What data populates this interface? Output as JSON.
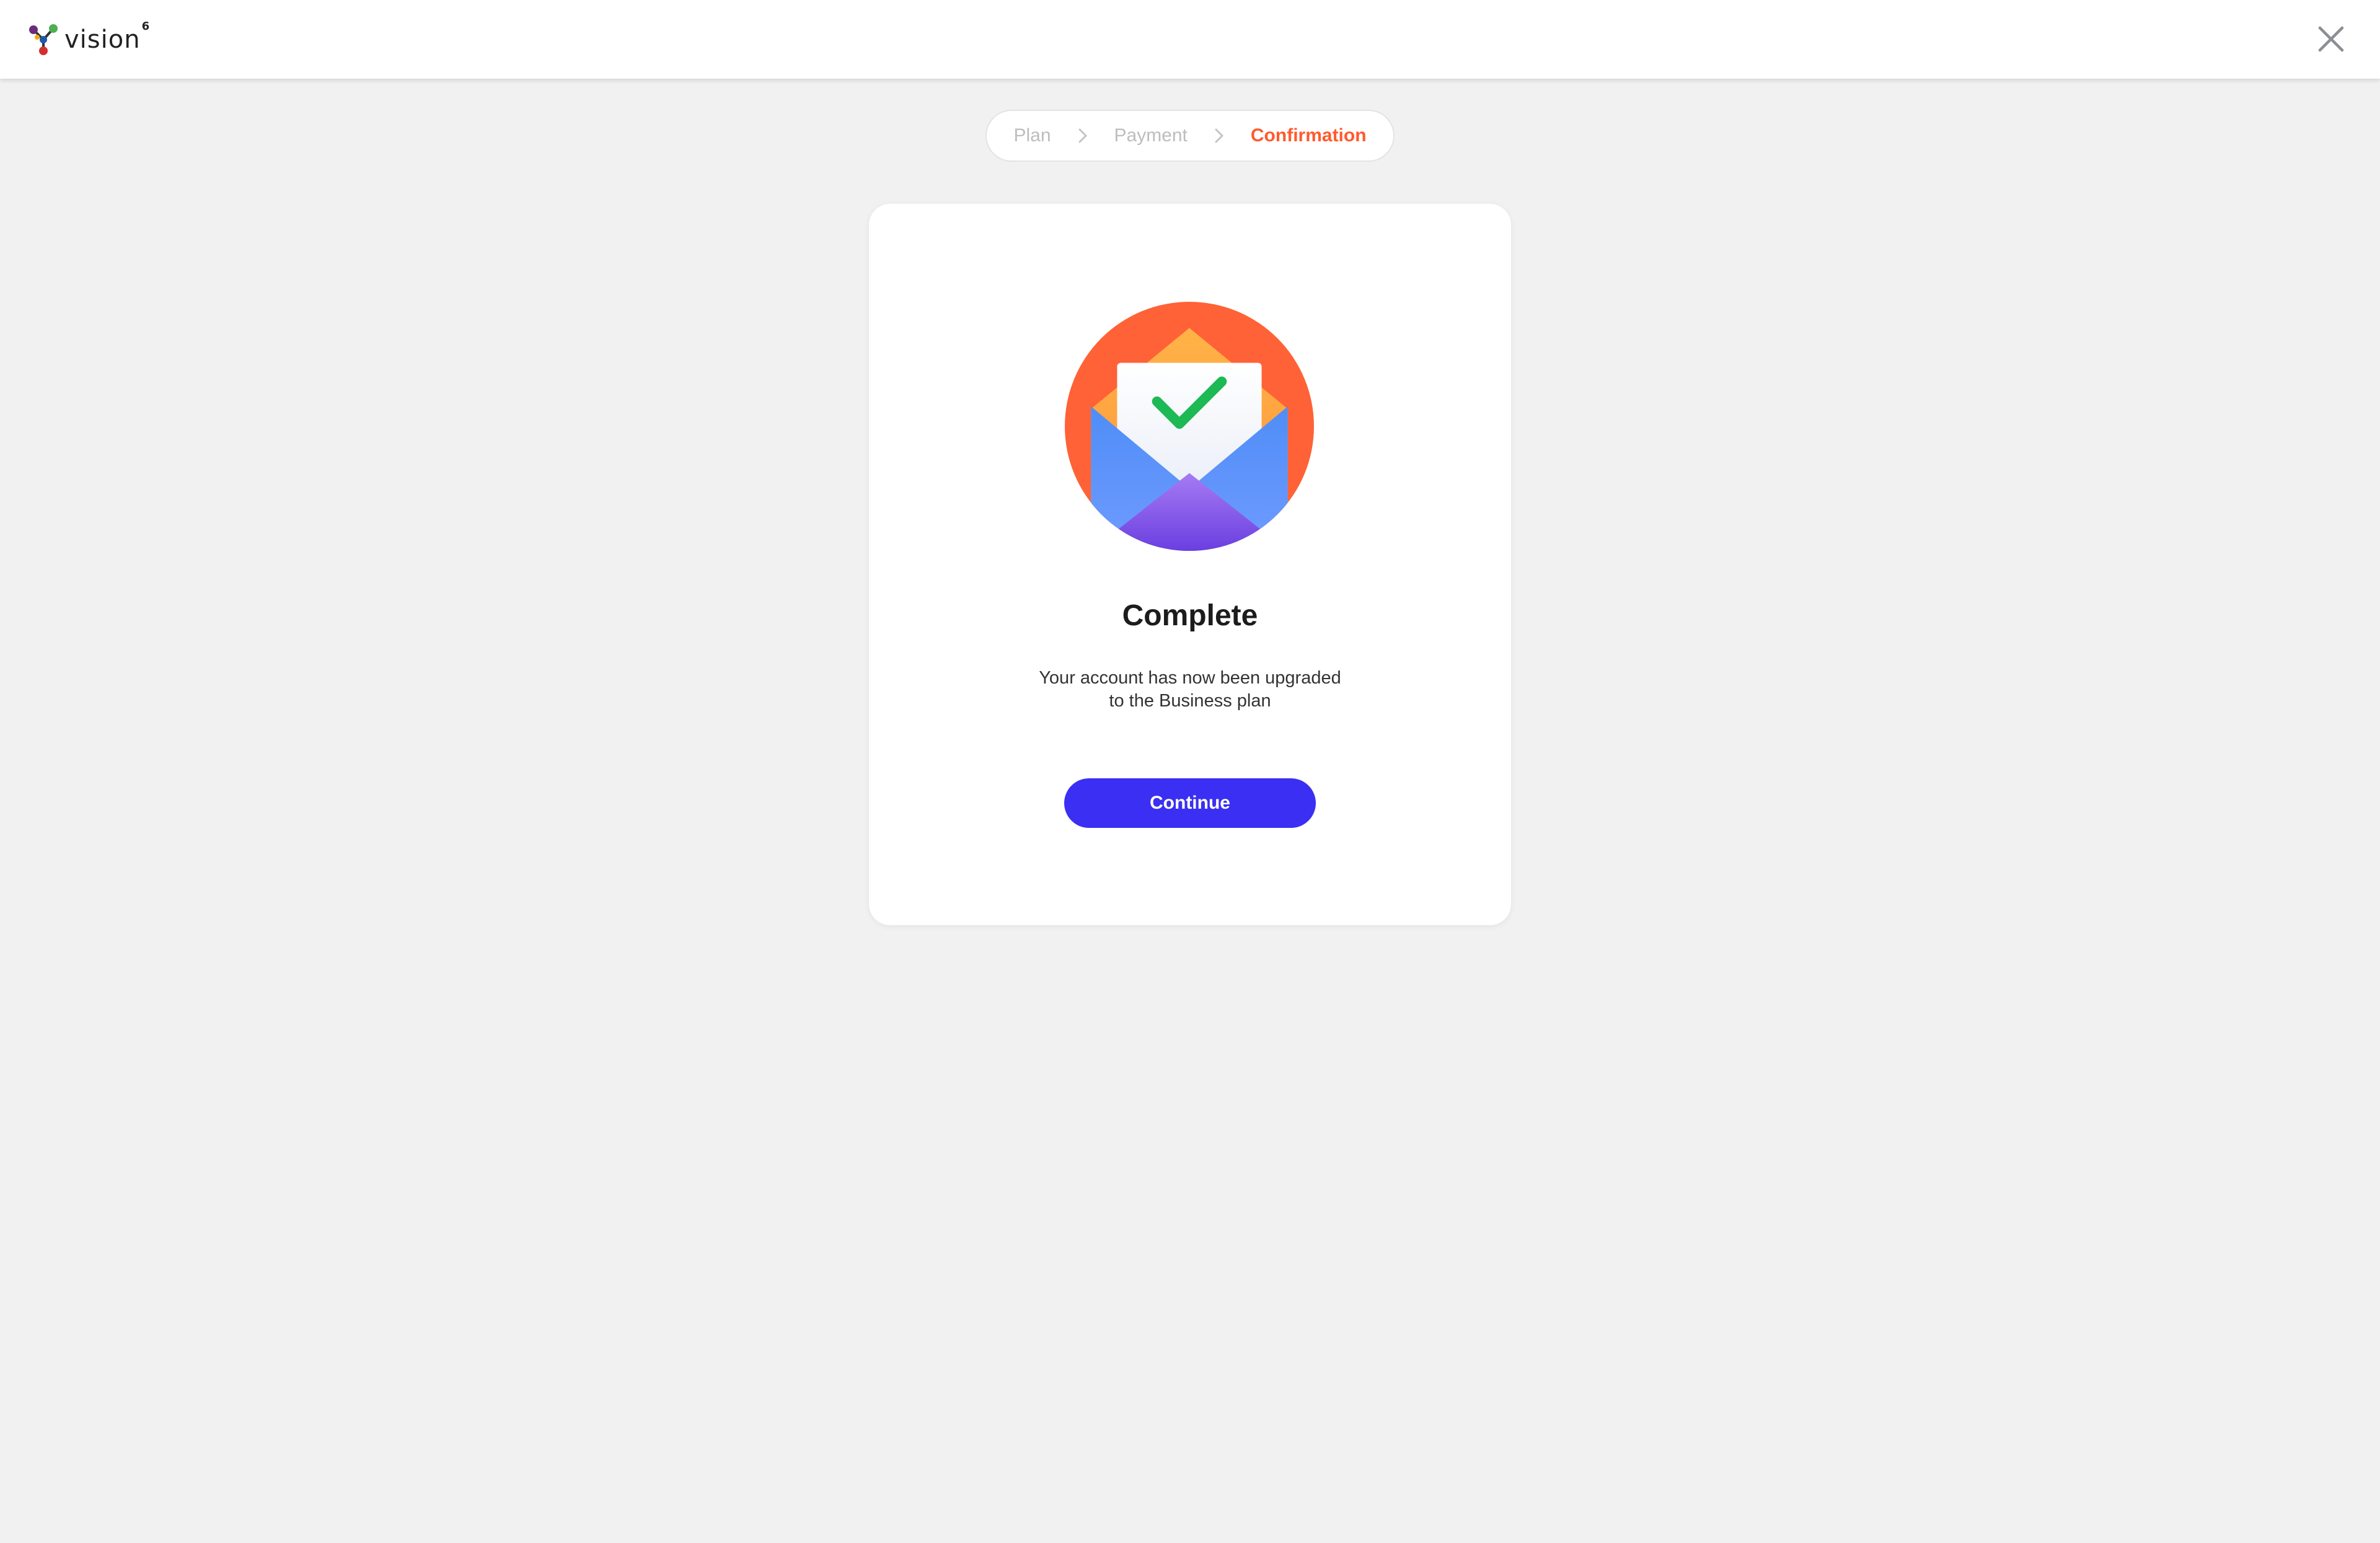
{
  "header": {
    "logo_text": "vision",
    "logo_superscript": "6",
    "close_icon": "close-icon"
  },
  "stepper": {
    "steps": [
      {
        "label": "Plan",
        "state": "inactive"
      },
      {
        "label": "Payment",
        "state": "inactive"
      },
      {
        "label": "Confirmation",
        "state": "active"
      }
    ],
    "separator_icon": "chevron-right-icon"
  },
  "card": {
    "illustration_icon": "envelope-check-icon",
    "title": "Complete",
    "message": "Your account has now been upgraded to the Business plan",
    "continue_label": "Continue"
  },
  "colors": {
    "background": "#f0f1f0",
    "accent_active_step": "#ff5a2e",
    "primary_button": "#3a2ff2",
    "illustration_circle": "#ff6236",
    "check": "#1db954"
  }
}
